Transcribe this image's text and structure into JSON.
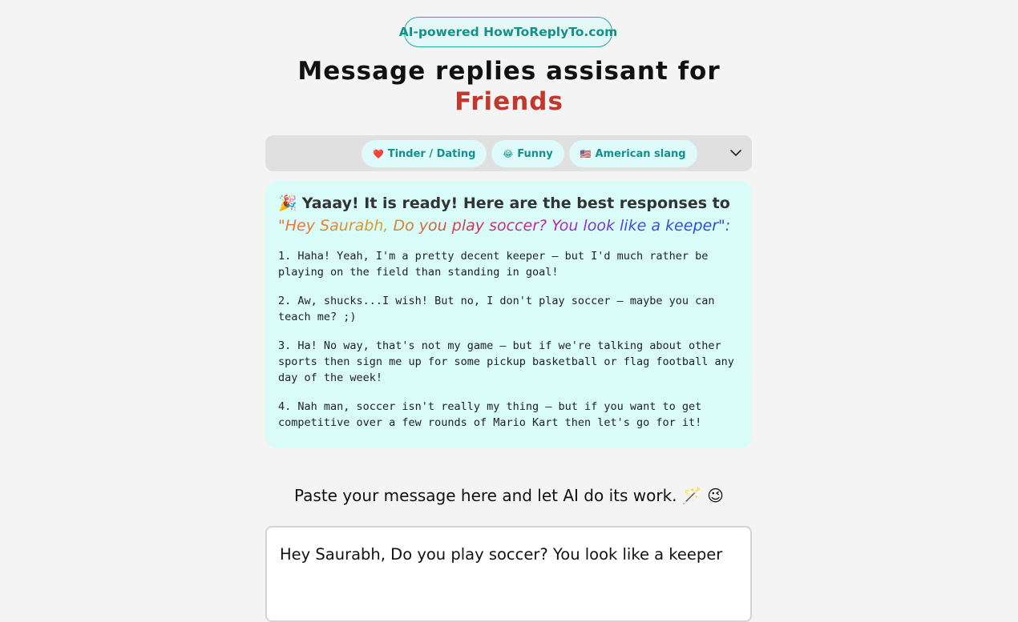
{
  "badge": "AI-powered HowToReplyTo.com",
  "title": {
    "line1": "Message replies assisant for",
    "line2": "Friends"
  },
  "tags": [
    {
      "icon": "❤️",
      "icon_name": "heart-icon",
      "label": "Tinder / Dating"
    },
    {
      "icon": "😂",
      "icon_name": "laughing-face-icon",
      "label": "Funny"
    },
    {
      "icon": "🇺🇸",
      "icon_name": "us-flag-icon",
      "label": "American slang"
    }
  ],
  "result": {
    "emoji": "🎉",
    "lead": "Yaaay! It is ready! Here are the best responses to",
    "quoted_message": "\"Hey Saurabh, Do you play soccer? You look like a keeper\":",
    "responses": [
      "1. Haha! Yeah, I'm a pretty decent keeper – but I'd much rather be playing on the field than standing in goal!",
      "2. Aw, shucks...I wish! But no, I don't play soccer – maybe you can teach me? ;)",
      "3. Ha! No way, that's not my game – but if we're talking about other sports then sign me up for some pickup basketball or flag football any day of the week!",
      "4. Nah man, soccer isn't really my thing – but if you want to get competitive over a few rounds of Mario Kart then let's go for it!"
    ]
  },
  "prompt": "Paste your message here and let AI do its work. 🪄 😉",
  "input_value": "Hey Saurabh, Do you play soccer? You look like a keeper",
  "colors": {
    "accent_red": "#c2382c",
    "teal": "#16908a",
    "result_bg": "#d9fcf9"
  }
}
